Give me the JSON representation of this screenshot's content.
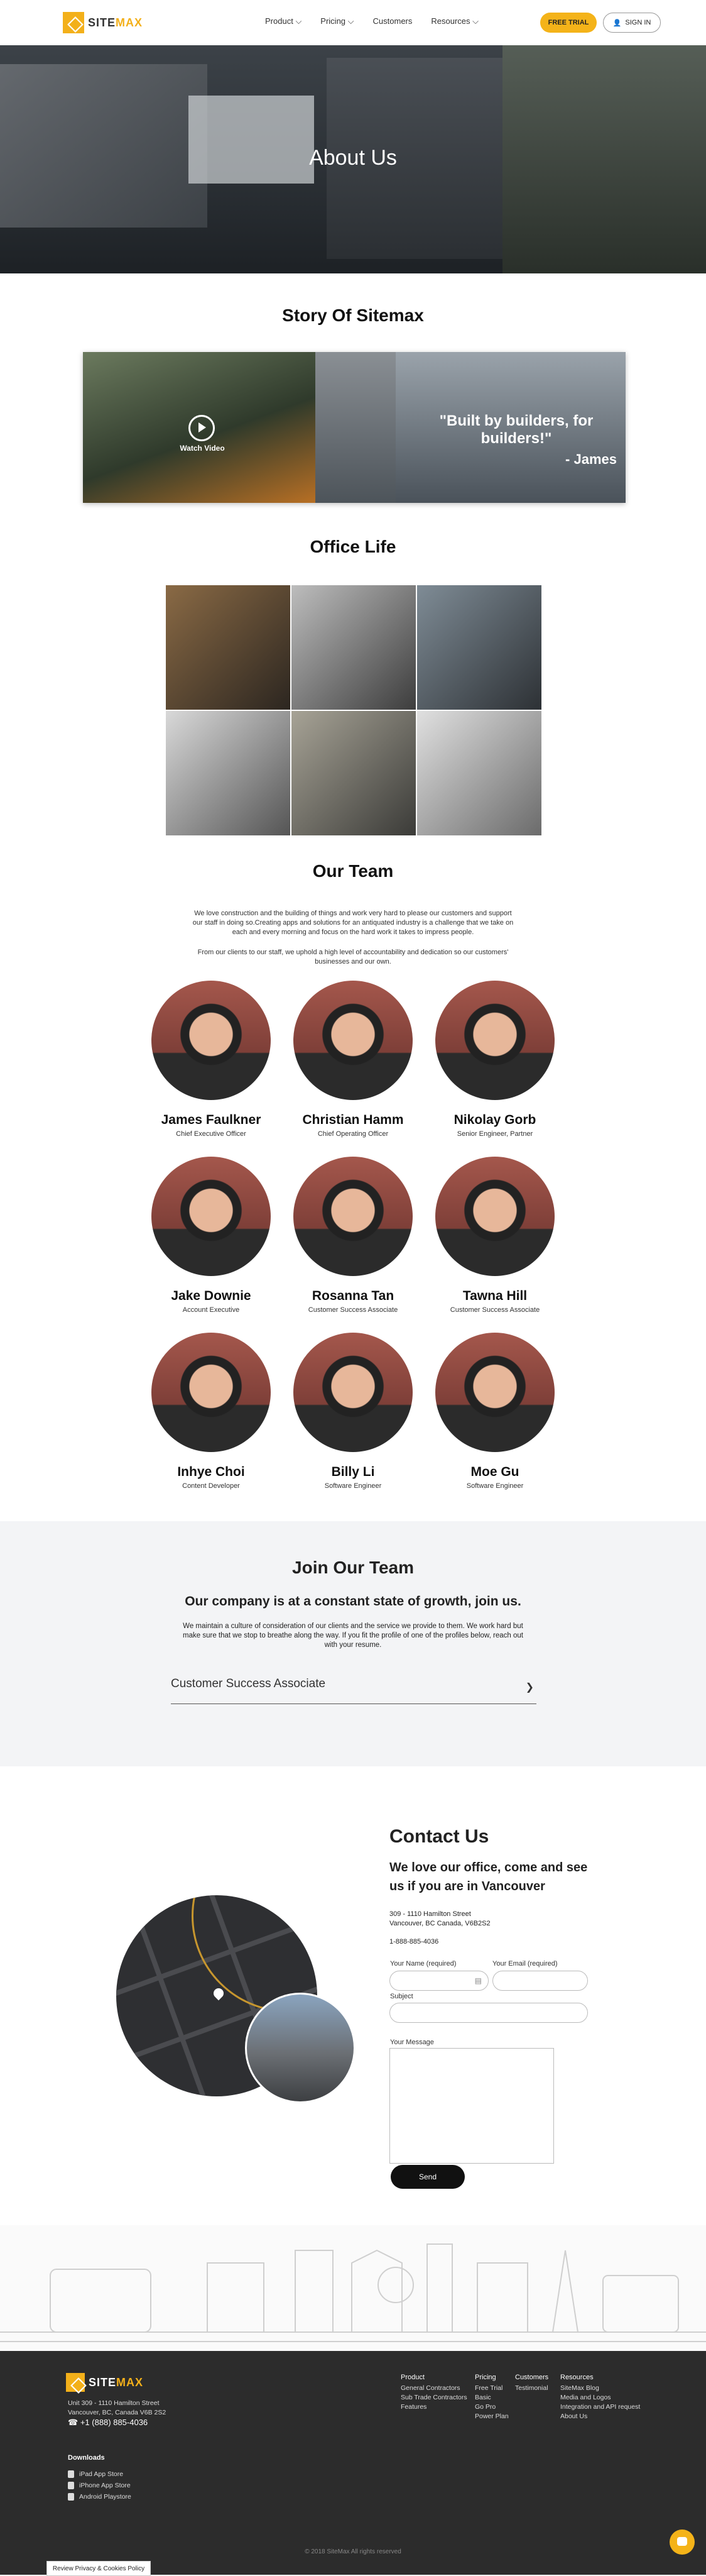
{
  "nav": {
    "logo_text_a": "SITE",
    "logo_text_b": "MAX",
    "links": [
      "Product",
      "Pricing",
      "Customers",
      "Resources"
    ],
    "trial": "FREE TRIAL",
    "signin": "SIGN IN"
  },
  "hero": {
    "title": "About Us"
  },
  "story": {
    "title": "Story Of Sitemax",
    "watch": "Watch Video",
    "quote": "\"Built by builders, for builders!\"",
    "author": "- James"
  },
  "office": {
    "title": "Office Life"
  },
  "team": {
    "title": "Our Team",
    "intro1": "We love construction and the building of things and work very hard to please our customers and support our staff in doing so.Creating apps and solutions for an antiquated industry is a challenge that we take on each and every morning and focus on the hard work it takes to impress people.",
    "intro2": "From our clients to our staff, we uphold a high level of accountability and dedication so our customers' businesses and our own.",
    "members": [
      {
        "name": "James Faulkner",
        "role": "Chief Executive Officer"
      },
      {
        "name": "Christian Hamm",
        "role": "Chief Operating Officer"
      },
      {
        "name": "Nikolay Gorb",
        "role": "Senior Engineer, Partner"
      },
      {
        "name": "Jake Downie",
        "role": "Account Executive"
      },
      {
        "name": "Rosanna Tan",
        "role": "Customer Success Associate"
      },
      {
        "name": "Tawna Hill",
        "role": "Customer Success Associate"
      },
      {
        "name": "Inhye Choi",
        "role": "Content Developer"
      },
      {
        "name": "Billy Li",
        "role": "Software Engineer"
      },
      {
        "name": "Moe Gu",
        "role": "Software Engineer"
      }
    ]
  },
  "join": {
    "title": "Join Our Team",
    "subtitle": "Our company is at a constant state of growth, join us.",
    "text": "We maintain a culture of consideration of our clients and the service we provide to them. We work hard but make sure that we stop to breathe along the way. If you fit the profile of one of the profiles below, reach out with your resume.",
    "selected": "Customer Success Associate"
  },
  "contact": {
    "title": "Contact Us",
    "subtitle": "We love our office, come and see us if you are in Vancouver",
    "addr1": "309 - 1110 Hamilton Street",
    "addr2": "Vancouver, BC Canada, V6B2S2",
    "phone": "1-888-885-4036",
    "name_label": "Your Name (required)",
    "email_label": "Your Email (required)",
    "subject_label": "Subject",
    "message_label": "Your Message",
    "send": "Send"
  },
  "footer": {
    "addr1": "Unit 309 - 1110 Hamilton Street",
    "addr2": "Vancouver, BC, Canada V6B 2S2",
    "phone": "+1 (888) 885-4036",
    "downloads_title": "Downloads",
    "downloads": [
      "iPad App Store",
      "iPhone App Store",
      "Android Playstore"
    ],
    "columns": [
      {
        "head": "Product",
        "items": [
          "General Contractors",
          "Sub Trade Contractors",
          "Features"
        ]
      },
      {
        "head": "Pricing",
        "items": [
          "Free Trial",
          "Basic",
          "Go Pro",
          "Power Plan"
        ]
      },
      {
        "head": "Customers",
        "items": [
          "Testimonial"
        ]
      },
      {
        "head": "Resources",
        "items": [
          "SiteMax Blog",
          "Media and Logos",
          "Integration and API request",
          "About Us"
        ]
      }
    ],
    "copyright": "© 2018 SiteMax All rights reserved",
    "cookie": "Review Privacy & Cookies Policy"
  }
}
